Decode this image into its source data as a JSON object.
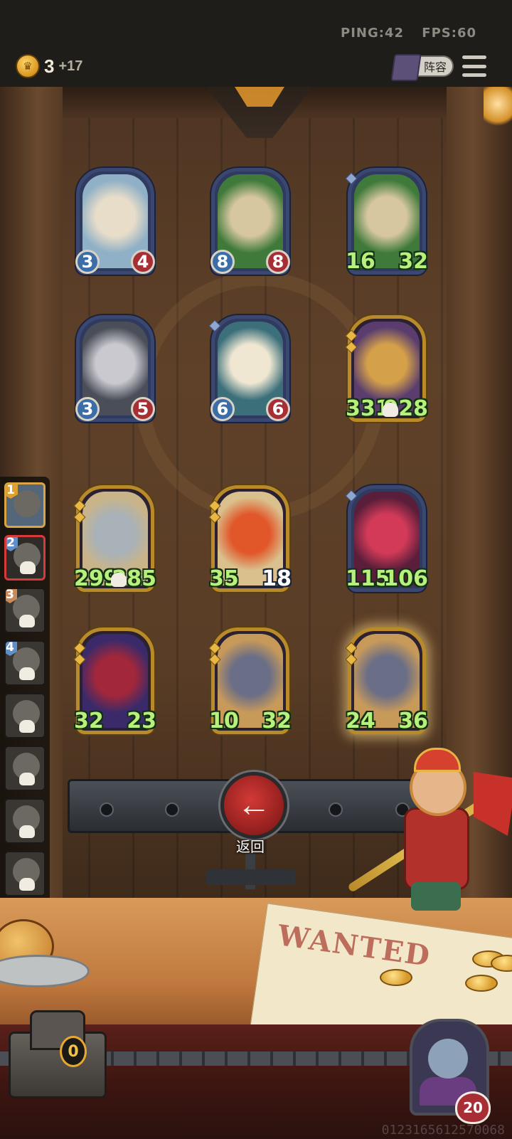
{
  "hud": {
    "ping_label": "PING:42",
    "fps_label": "FPS:60",
    "gold": "3",
    "gold_income": "+17",
    "lineup_label": "阵容"
  },
  "board": {
    "cards": [
      {
        "atk": "3",
        "hp": "4",
        "frame": "blue",
        "atk_style": "badge",
        "hp_style": "badge",
        "art": "white-dragon"
      },
      {
        "atk": "8",
        "hp": "8",
        "frame": "blue",
        "atk_style": "badge",
        "hp_style": "badge",
        "art": "green-dragon"
      },
      {
        "atk": "16",
        "hp": "32",
        "frame": "blue",
        "atk_style": "green",
        "hp_style": "green",
        "art": "green-dragon"
      },
      {
        "atk": "3",
        "hp": "5",
        "frame": "blue",
        "atk_style": "badge",
        "hp_style": "badge",
        "art": "shadow-dragon"
      },
      {
        "atk": "6",
        "hp": "6",
        "frame": "blue",
        "atk_style": "badge",
        "hp_style": "badge",
        "art": "cloud-dragon"
      },
      {
        "atk": "331",
        "hp": "928",
        "frame": "gold",
        "atk_style": "green",
        "hp_style": "green",
        "art": "monkey-king"
      },
      {
        "atk": "299",
        "hp": "285",
        "frame": "gold",
        "atk_style": "green",
        "hp_style": "green",
        "art": "robot-squid"
      },
      {
        "atk": "35",
        "hp": "18",
        "frame": "gold",
        "atk_style": "green",
        "hp_style": "white",
        "art": "phoenix"
      },
      {
        "atk": "115",
        "hp": "106",
        "frame": "blue",
        "atk_style": "green",
        "hp_style": "green",
        "art": "jester"
      },
      {
        "atk": "32",
        "hp": "23",
        "frame": "gold",
        "atk_style": "green",
        "hp_style": "green",
        "art": "red-mage"
      },
      {
        "atk": "10",
        "hp": "32",
        "frame": "gold",
        "atk_style": "green",
        "hp_style": "green",
        "art": "rat"
      },
      {
        "atk": "24",
        "hp": "36",
        "frame": "gold",
        "atk_style": "green",
        "hp_style": "green",
        "art": "rat"
      }
    ]
  },
  "queue": {
    "items": [
      {
        "rank": "1",
        "state": "first"
      },
      {
        "rank": "2",
        "state": "selected"
      },
      {
        "rank": "3",
        "state": "eliminated"
      },
      {
        "rank": "4",
        "state": "eliminated"
      },
      {
        "rank": "",
        "state": "eliminated"
      },
      {
        "rank": "",
        "state": "eliminated"
      },
      {
        "rank": "",
        "state": "eliminated"
      },
      {
        "rank": "",
        "state": "eliminated"
      }
    ]
  },
  "controls": {
    "return_label": "返回",
    "chest_count": "0",
    "lives": "20"
  },
  "decor": {
    "poster_text": "WANTED",
    "user_id": "0123165612570068"
  },
  "colors": {
    "atk_badge": "#3b6ea8",
    "hp_badge": "#a82e35",
    "buff_green": "#b7f07b",
    "gold_frame": "#b88a2a",
    "blue_frame": "#3a4770"
  }
}
